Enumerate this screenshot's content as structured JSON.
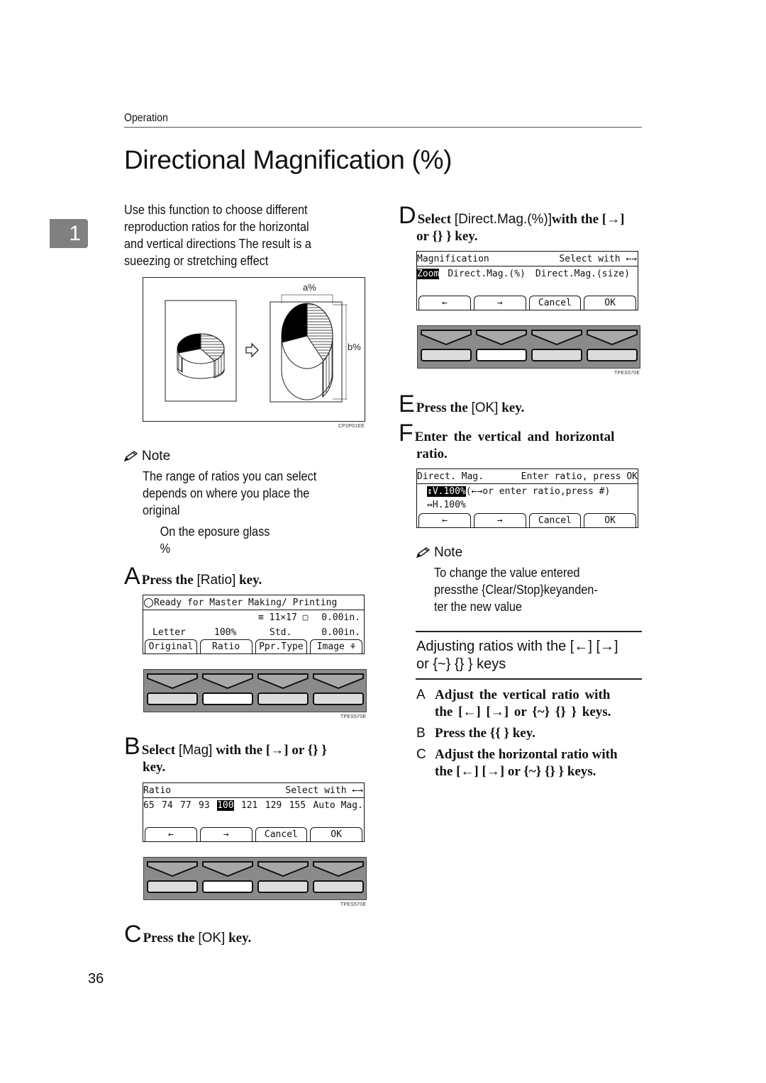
{
  "header": {
    "running_head": "Operation",
    "title": "Directional Magnification (%)",
    "chapter_tab": "1"
  },
  "intro": {
    "lines": [
      "Use this function to choose different",
      "reproduction ratios for the horizontal",
      "and vertical directions The result is a",
      "sueezing or stretching effect"
    ]
  },
  "figure": {
    "label_a": "a%",
    "label_b": "b%",
    "code": "CP2P01EE",
    "arrow_icon": "outline-right-arrow"
  },
  "note1": {
    "heading": "Note",
    "lines": [
      "The range of ratios you can select",
      "depends on where you place the",
      "original"
    ],
    "sub_lines": [
      "On   the   eposure   glass",
      "%"
    ]
  },
  "steps_left": {
    "A": {
      "letter": "A",
      "pre": "Press the ",
      "key": "[Ratio]",
      "post": " key."
    },
    "B": {
      "letter": "B",
      "pre": "Select ",
      "key": "[Mag]",
      "post": " with the [→] or {} }",
      "line2": "key."
    },
    "C": {
      "letter": "C",
      "pre": "Press the ",
      "key": "[OK]",
      "post": " key."
    }
  },
  "lcd_main": {
    "status": "Ready for Master Making/ Printing",
    "row2_paper": "≡ 11×17 ▢",
    "row2_value": "0.00in.",
    "row3": [
      "Letter",
      "100%",
      "Std.",
      "0.00in."
    ],
    "buttons": [
      "Original",
      "Ratio",
      "Ppr.Type",
      "Image ⚘"
    ]
  },
  "lcd_ratio": {
    "title": "Ratio",
    "hint": "Select with ←→",
    "options": [
      "65",
      "74",
      "77",
      "93",
      "100",
      "121",
      "129",
      "155",
      "Auto Mag."
    ],
    "selected": "100",
    "buttons": [
      "←",
      "→",
      "Cancel",
      "OK"
    ]
  },
  "panel_code": "TPES570E",
  "steps_right": {
    "D": {
      "letter": "D",
      "pre": "Select ",
      "key": "[Direct.Mag.(%)]",
      "post": "with the [→]",
      "line2": "or {} }  key."
    },
    "E": {
      "letter": "E",
      "pre": "Press the ",
      "key": "[OK]",
      "post": " key."
    },
    "F": {
      "letter": "F",
      "text": "Enter the vertical and horizontal",
      "line2": "ratio."
    }
  },
  "lcd_mag": {
    "title": "Magnification",
    "hint": "Select with ←→",
    "options": [
      "Zoom",
      "Direct.Mag.(%)",
      "Direct.Mag.(size)"
    ],
    "selected": "Zoom",
    "buttons": [
      "←",
      "→",
      "Cancel",
      "OK"
    ]
  },
  "lcd_direct": {
    "title": "Direct. Mag.",
    "hint": "Enter ratio, press OK",
    "v_value": "↕V.100%",
    "v_hint": "(←→or enter ratio,press #)",
    "h_value": "↔H.100%",
    "buttons": [
      "←",
      "→",
      "Cancel",
      "OK"
    ]
  },
  "note2": {
    "heading": "Note",
    "lines": [
      "To  change  the  value  entered",
      "pressthe  {Clear/Stop}keyanden-",
      "ter the new value"
    ]
  },
  "section": {
    "heading_line1": "Adjusting ratios with the [←] [→]",
    "heading_line2": "or {~} {} }  keys",
    "items": [
      {
        "letter": "A",
        "line1": "Adjust  the  vertical  ratio  with",
        "line2": "the [←] [→] or {~} {} } keys."
      },
      {
        "letter": "B",
        "line1": "Press the {{ } key.",
        "line2": ""
      },
      {
        "letter": "C",
        "line1": "Adjust the horizontal ratio with",
        "line2": "the [←] [→] or {~} {} } keys."
      }
    ]
  },
  "page_number": "36"
}
